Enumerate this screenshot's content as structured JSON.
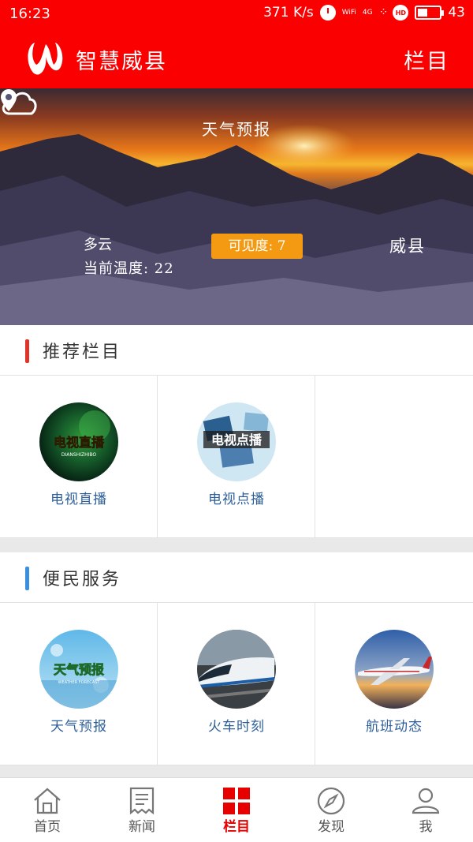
{
  "status_bar": {
    "time": "16:23",
    "speed": "371 K/s",
    "wifi_label": "WiFi",
    "network": "4G",
    "hd": "HD",
    "battery": "43",
    "battery_level": 0.43
  },
  "header": {
    "app_title": "智慧威县",
    "menu_label": "栏目",
    "brand_color": "#fb0000"
  },
  "weather": {
    "title": "天气预报",
    "condition": "多云",
    "temperature": "当前温度: 22",
    "visibility": "可见度: 7",
    "location": "威县"
  },
  "sections": [
    {
      "title": "推荐栏目",
      "bar_color": "#e0342a",
      "items": [
        {
          "label": "电视直播",
          "thumb_text": "电视直播",
          "thumb_sub": "DIANSHIZHIBO",
          "icon": "tv-live-icon"
        },
        {
          "label": "电视点播",
          "thumb_text": "电视点播",
          "icon": "tv-ondemand-icon"
        }
      ]
    },
    {
      "title": "便民服务",
      "bar_color": "#3b8fe0",
      "items": [
        {
          "label": "天气预报",
          "thumb_text": "天气预报",
          "thumb_sub": "WEATHER FORECAST",
          "icon": "weather-forecast-icon"
        },
        {
          "label": "火车时刻",
          "icon": "train-icon"
        },
        {
          "label": "航班动态",
          "icon": "airplane-icon"
        }
      ]
    }
  ],
  "tabs": [
    {
      "label": "首页",
      "icon": "home-icon"
    },
    {
      "label": "新闻",
      "icon": "news-icon"
    },
    {
      "label": "栏目",
      "icon": "grid-icon",
      "active": true
    },
    {
      "label": "发现",
      "icon": "compass-icon"
    },
    {
      "label": "我",
      "icon": "user-icon"
    }
  ]
}
